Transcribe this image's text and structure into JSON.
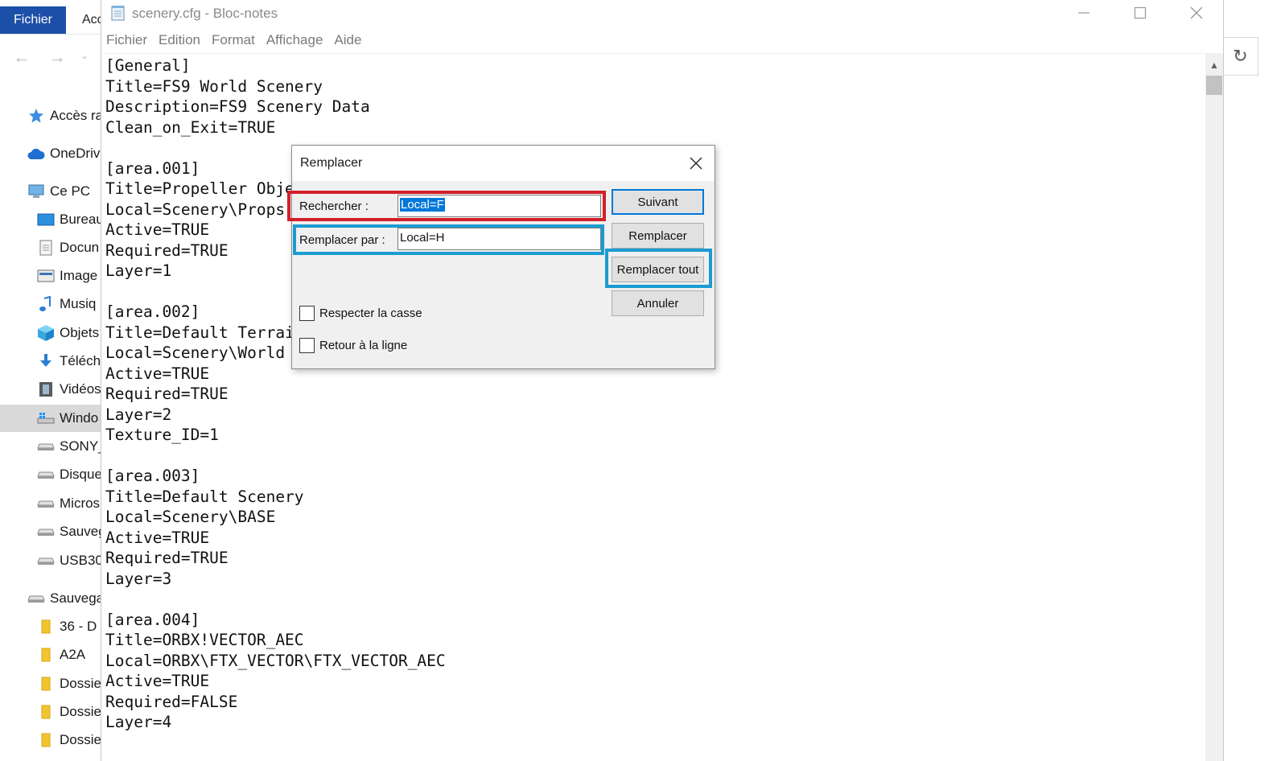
{
  "explorer": {
    "ribbon_file": "Fichier",
    "ribbon_acc": "Acc",
    "back_glyph": "←",
    "forward_glyph": "→",
    "dropdown_glyph": "⌄",
    "refresh_glyph": "↻",
    "tree": [
      {
        "label": "Accès ra",
        "icon": "star-icon",
        "indent": 0
      },
      {
        "label": "OneDriv",
        "icon": "cloud-icon",
        "indent": 0
      },
      {
        "label": "Ce PC",
        "icon": "computer-icon",
        "indent": 0
      },
      {
        "label": "Bureau",
        "icon": "desktop-icon",
        "indent": 1
      },
      {
        "label": "Docun",
        "icon": "document-icon",
        "indent": 1
      },
      {
        "label": "Image",
        "icon": "image-icon",
        "indent": 1
      },
      {
        "label": "Musiq",
        "icon": "music-icon",
        "indent": 1
      },
      {
        "label": "Objets",
        "icon": "cube-icon",
        "indent": 1
      },
      {
        "label": "Téléch",
        "icon": "download-icon",
        "indent": 1
      },
      {
        "label": "Vidéos",
        "icon": "video-icon",
        "indent": 1
      },
      {
        "label": "Windo",
        "icon": "windows-drive-icon",
        "indent": 1,
        "selected": true
      },
      {
        "label": "SONY_",
        "icon": "drive-icon",
        "indent": 1
      },
      {
        "label": "Disque",
        "icon": "drive-icon",
        "indent": 1
      },
      {
        "label": "Micros",
        "icon": "drive-icon",
        "indent": 1
      },
      {
        "label": "Sauveg",
        "icon": "drive-icon",
        "indent": 1
      },
      {
        "label": "USB30",
        "icon": "drive-icon",
        "indent": 1
      },
      {
        "label": "Sauvega",
        "icon": "drive-icon",
        "indent": 0
      },
      {
        "label": "36 - D",
        "icon": "folder-icon",
        "indent": 1
      },
      {
        "label": "A2A",
        "icon": "folder-icon",
        "indent": 1
      },
      {
        "label": "Dossie",
        "icon": "folder-icon",
        "indent": 1
      },
      {
        "label": "Dossie",
        "icon": "folder-icon",
        "indent": 1
      },
      {
        "label": "Dossie",
        "icon": "folder-icon",
        "indent": 1
      }
    ]
  },
  "notepad": {
    "title": "scenery.cfg - Bloc-notes",
    "menu": [
      "Fichier",
      "Edition",
      "Format",
      "Affichage",
      "Aide"
    ],
    "scroll_up_glyph": "▲",
    "lines": [
      "[General]",
      "Title=FS9 World Scenery",
      "Description=FS9 Scenery Data",
      "Clean_on_Exit=TRUE",
      "",
      "[area.001]",
      "Title=Propeller Obje",
      "Local=Scenery\\Props",
      "Active=TRUE",
      "Required=TRUE",
      "Layer=1",
      "",
      "[area.002]",
      "Title=Default Terrai",
      "Local=Scenery\\World",
      "Active=TRUE",
      "Required=TRUE",
      "Layer=2",
      "Texture_ID=1",
      "",
      "[area.003]",
      "Title=Default Scenery",
      "Local=Scenery\\BASE",
      "Active=TRUE",
      "Required=TRUE",
      "Layer=3",
      "",
      "[area.004]",
      "Title=ORBX!VECTOR_AEC",
      "Local=ORBX\\FTX_VECTOR\\FTX_VECTOR_AEC",
      "Active=TRUE",
      "Required=FALSE",
      "Layer=4"
    ]
  },
  "dialog": {
    "title": "Remplacer",
    "find_label": "Rechercher :",
    "find_value": "Local=F",
    "replace_label": "Remplacer par :",
    "replace_value": "Local=H",
    "buttons": {
      "next": "Suivant",
      "replace": "Remplacer",
      "replace_all": "Remplacer tout",
      "cancel": "Annuler"
    },
    "match_case_label": "Respecter la casse",
    "match_case_checked": false,
    "wrap_label": "Retour à la ligne",
    "wrap_checked": false
  },
  "colors": {
    "ribbon_blue": "#1c4fa8",
    "highlight_red": "#d21f2b",
    "highlight_blue": "#1b9bd1",
    "selection_blue": "#0078d7"
  }
}
